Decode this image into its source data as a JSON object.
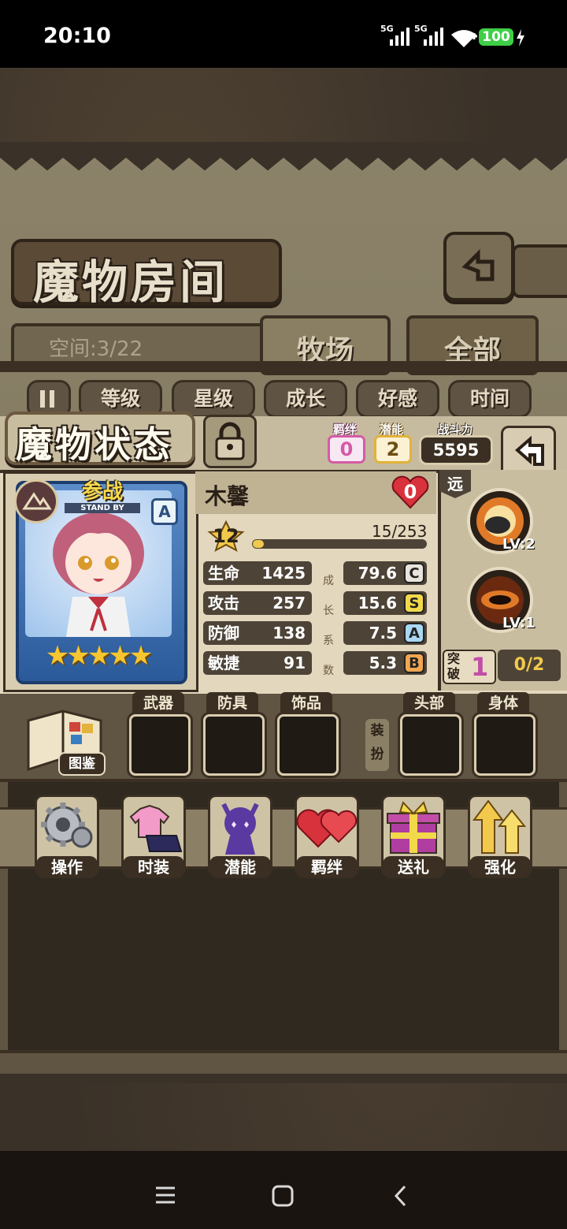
{
  "status_bar": {
    "time": "20:10",
    "network_1": "5G",
    "network_2": "5G",
    "battery": "100"
  },
  "room": {
    "title": "魔物房间",
    "space": "空间:3/22",
    "tabs": [
      "牧场",
      "全部"
    ],
    "sort_filters": [
      "等级",
      "星级",
      "成长",
      "好感",
      "时间"
    ]
  },
  "status": {
    "title": "魔物状态",
    "bond_label": "羁绊",
    "bond_value": "0",
    "potential_label": "潜能",
    "potential_value": "2",
    "power_label": "战斗力",
    "power_value": "5595"
  },
  "monster": {
    "name": "木馨",
    "card_badge": "参战",
    "card_badge_sub": "STAND BY",
    "rank_badge": "A",
    "stars": 5,
    "heart_value": "0",
    "level": "12",
    "exp": "15/253",
    "exp_ratio": 0.06,
    "stats": [
      {
        "label": "生命",
        "value": "1425",
        "growth": "79.6",
        "grade": "C",
        "grade_color": "#e8e4dc"
      },
      {
        "label": "攻击",
        "value": "257",
        "growth": "15.6",
        "grade": "S",
        "grade_color": "#f2d94a"
      },
      {
        "label": "防御",
        "value": "138",
        "growth": "7.5",
        "grade": "A",
        "grade_color": "#a9d8f2"
      },
      {
        "label": "敏捷",
        "value": "91",
        "growth": "5.3",
        "grade": "B",
        "grade_color": "#f2a650"
      }
    ],
    "growth_chars": [
      "成",
      "长",
      "系",
      "数"
    ]
  },
  "skills": {
    "range_label": "远",
    "skill_1_level": "LV:2",
    "skill_2_level": "LV:1",
    "breakthrough_label_1": "突",
    "breakthrough_label_2": "破",
    "breakthrough_value": "1",
    "breakthrough_progress": "0/2"
  },
  "equipment": {
    "book_label": "图鉴",
    "slots": [
      "武器",
      "防具",
      "饰品"
    ],
    "outfit_label_1": "装",
    "outfit_label_2": "扮",
    "outfit_slots": [
      "头部",
      "身体"
    ]
  },
  "actions": [
    {
      "label": "操作",
      "icon": "gear-icon"
    },
    {
      "label": "时装",
      "icon": "outfit-icon"
    },
    {
      "label": "潜能",
      "icon": "demon-icon"
    },
    {
      "label": "羁绊",
      "icon": "hearts-icon"
    },
    {
      "label": "送礼",
      "icon": "gift-icon"
    },
    {
      "label": "强化",
      "icon": "upgrade-arrows-icon"
    }
  ],
  "colors": {
    "bond": "#d45ba7",
    "potential": "#e2b23a",
    "level": "#f2c94c",
    "heart": "#d8323c"
  }
}
